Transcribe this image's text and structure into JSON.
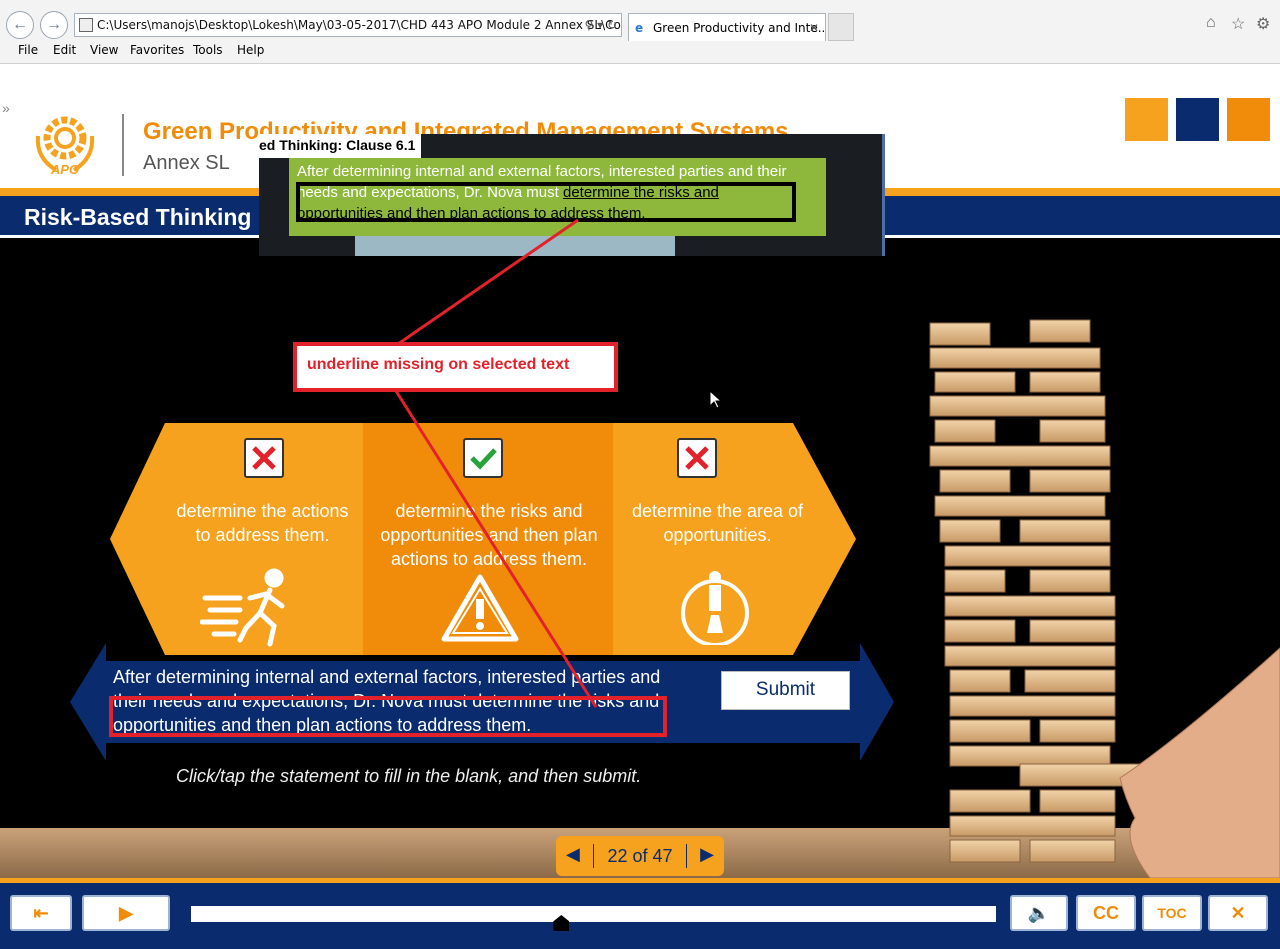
{
  "browser": {
    "address": "C:\\Users\\manojs\\Desktop\\Lokesh\\May\\03-05-2017\\CHD 443 APO Module 2 Annex SL\\Co",
    "tab_title": "Green Productivity and Inte...",
    "menu": [
      "File",
      "Edit",
      "View",
      "Favorites",
      "Tools",
      "Help"
    ]
  },
  "course": {
    "logo_text": "APO",
    "title": "Green Productivity and Integrated Management Systems",
    "subtitle": "Annex SL",
    "slide_title": "Risk-Based Thinking",
    "brand_colors": [
      "#f6a21e",
      "#0a2c6e",
      "#f08c0a"
    ]
  },
  "overlay": {
    "title": "ed Thinking:  Clause 6.1",
    "text_plain": "After determining internal and external factors, interested parties and their needs and expectations, Dr. Nova must ",
    "text_underlined": "determine the risks and opportunities and then plan actions to address them."
  },
  "annotation": {
    "label": "underline missing on selected text",
    "color": "#e3212b"
  },
  "options": [
    {
      "label": "determine the actions to address them.",
      "state": "incorrect",
      "icon": "running-person-icon"
    },
    {
      "label": "determine the risks and opportunities and then plan actions to address them.",
      "state": "correct",
      "icon": "warning-triangle-icon"
    },
    {
      "label": "determine the area of opportunities.",
      "state": "incorrect",
      "icon": "person-target-icon"
    }
  ],
  "statement": "After determining internal and external factors, interested parties and their needs and expectations, Dr. Nova must determine the risks and opportunities and then plan actions to address them.",
  "submit_label": "Submit",
  "instruction": "Click/tap the statement to fill in the blank, and then submit.",
  "pager": {
    "label": "22 of 47",
    "current": 22,
    "total": 47
  },
  "player": {
    "cc_label": "CC",
    "toc_label": "TOC",
    "progress": 0.46
  }
}
